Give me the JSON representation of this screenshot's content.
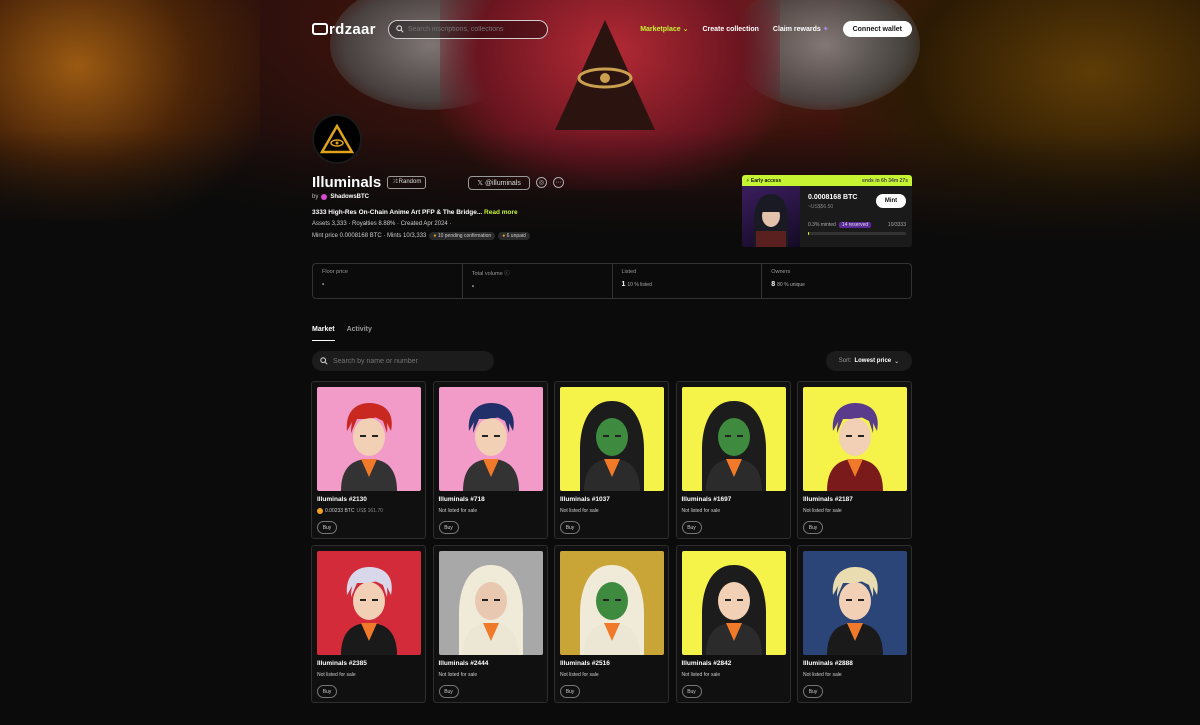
{
  "nav": {
    "logo_text": "rdzaar",
    "search_placeholder": "Search inscriptions, collections",
    "marketplace": "Marketplace",
    "create_collection": "Create collection",
    "claim_rewards": "Claim rewards",
    "connect_wallet": "Connect wallet"
  },
  "collection": {
    "title": "Illuminals",
    "chip_random": "Random",
    "twitter_handle": "@illuminals",
    "by_prefix": "by",
    "creator": "ShadowsBTC",
    "description": "3333 High-Res On-Chain Anime Art PFP & The Bridge...",
    "read_more": "Read more",
    "meta_line": "Assets 3,333  ·  Royalties 8.88%  ·  Created  Apr 2024  ·",
    "mint_price_text": "Mint price 0.0008168 BTC  ·   Mints 10/3,333",
    "pending_badge": "10 pending confirmation",
    "unpaid_badge": "6 unpaid"
  },
  "mint_card": {
    "header_label": "Early access",
    "ends_text": "ends in 6h 34m 27s",
    "price": "0.0008168 BTC",
    "usd": "~US$56.50",
    "mint_button": "Mint",
    "minted_text": "0.3% minted",
    "reserved_text": "14 reserved",
    "count": "10/3333",
    "progress": 0.003
  },
  "stats": [
    {
      "label": "Floor price",
      "value": "-",
      "sub": ""
    },
    {
      "label": "Total volume",
      "value": "-",
      "sub": ""
    },
    {
      "label": "Listed",
      "value": "1",
      "sub": "10 % listed"
    },
    {
      "label": "Owners",
      "value": "8",
      "sub": "80 % unique"
    }
  ],
  "tabs": [
    "Market",
    "Activity"
  ],
  "search": {
    "placeholder": "Search by name or number"
  },
  "sort": {
    "label": "Sort:",
    "value": "Lowest price"
  },
  "items": [
    {
      "name": "Illuminals #2130",
      "status": "0.00233 BTC",
      "usd": "US$ 161.70",
      "listed": true,
      "bg": "#f29ac8",
      "skin": "#f1d0b5",
      "hair": "#c8281f",
      "shirt": "#333",
      "hood": false
    },
    {
      "name": "Illuminals #718",
      "status": "Not listed for sale",
      "usd": "",
      "listed": false,
      "bg": "#f29ac8",
      "skin": "#f1d0b5",
      "hair": "#22306a",
      "shirt": "#333",
      "hood": false
    },
    {
      "name": "Illuminals #1037",
      "status": "Not listed for sale",
      "usd": "",
      "listed": false,
      "bg": "#f5f249",
      "skin": "#3e8a3e",
      "hair": "#1c1c1c",
      "shirt": "#2b2b2b",
      "hood": true
    },
    {
      "name": "Illuminals #1697",
      "status": "Not listed for sale",
      "usd": "",
      "listed": false,
      "bg": "#f5f249",
      "skin": "#3e8a3e",
      "hair": "#1c1c1c",
      "shirt": "#2b2b2b",
      "hood": true
    },
    {
      "name": "Illuminals #2187",
      "status": "Not listed for sale",
      "usd": "",
      "listed": false,
      "bg": "#f5f249",
      "skin": "#f1d0b5",
      "hair": "#5a3a8a",
      "shirt": "#7a1a1a",
      "hood": false
    },
    {
      "name": "Illuminals #2385",
      "status": "Not listed for sale",
      "usd": "",
      "listed": false,
      "bg": "#d42b3a",
      "skin": "#f1d0b5",
      "hair": "#d8d8ea",
      "shirt": "#1a1a1a",
      "hood": false
    },
    {
      "name": "Illuminals #2444",
      "status": "Not listed for sale",
      "usd": "",
      "listed": false,
      "bg": "#a8a8a8",
      "skin": "#e8c8b0",
      "hair": "#f0ead8",
      "shirt": "#ece6d4",
      "hood": true
    },
    {
      "name": "Illuminals #2516",
      "status": "Not listed for sale",
      "usd": "",
      "listed": false,
      "bg": "#c9a437",
      "skin": "#3e8a3e",
      "hair": "#f0ead8",
      "shirt": "#ece6d4",
      "hood": true
    },
    {
      "name": "Illuminals #2842",
      "status": "Not listed for sale",
      "usd": "",
      "listed": false,
      "bg": "#f5f249",
      "skin": "#f1d0b5",
      "hair": "#1c1c1c",
      "shirt": "#2b2b2b",
      "hood": true
    },
    {
      "name": "Illuminals #2888",
      "status": "Not listed for sale",
      "usd": "",
      "listed": false,
      "bg": "#2c4578",
      "skin": "#f1d0b5",
      "hair": "#e8dcb0",
      "shirt": "#1a1a1a",
      "hood": false
    }
  ],
  "buy_label": "Buy",
  "colors": {
    "accent": "#c6f432",
    "background": "#0b0b0b",
    "card_border": "#2e2e2e"
  }
}
